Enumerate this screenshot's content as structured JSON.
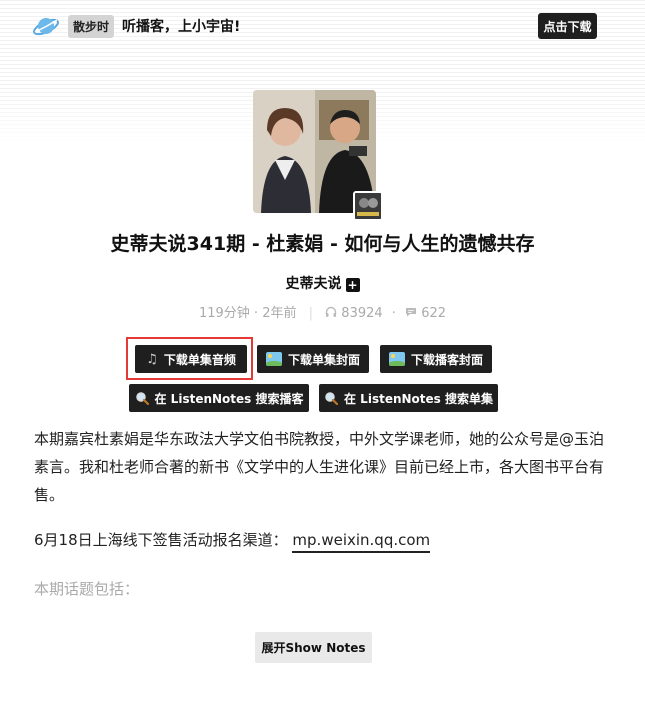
{
  "header": {
    "badge": "散步时",
    "slogan": "听播客，上小宇宙!",
    "download_label": "点击下载"
  },
  "episode": {
    "title": "史蒂夫说341期 - 杜素娟 - 如何与人生的遗憾共存",
    "podcast_name": "史蒂夫说",
    "duration": "119分钟",
    "published": "2年前",
    "plays": "83924",
    "comments": "622"
  },
  "buttons": {
    "download_audio": "下载单集音频",
    "download_episode_cover": "下载单集封面",
    "download_podcast_cover": "下载播客封面",
    "search_podcast": "在 ListenNotes 搜索播客",
    "search_episode": "在 ListenNotes 搜索单集"
  },
  "description": {
    "intro": "本期嘉宾杜素娟是华东政法大学文伯书院教授，中外文学课老师，她的公众号是@玉泊素言。我和杜老师合著的新书《文学中的人生进化课》目前已经上市，各大图书平台有售。",
    "signup_prefix": "6月18日上海线下签售活动报名渠道：",
    "signup_link": "mp.weixin.qq.com",
    "topics_label": "本期话题包括："
  },
  "show_notes_label": "展开Show Notes",
  "colors": {
    "button_bg": "#1f1f1f",
    "highlight_border": "#e53935",
    "muted_text": "#aaaaaa"
  }
}
